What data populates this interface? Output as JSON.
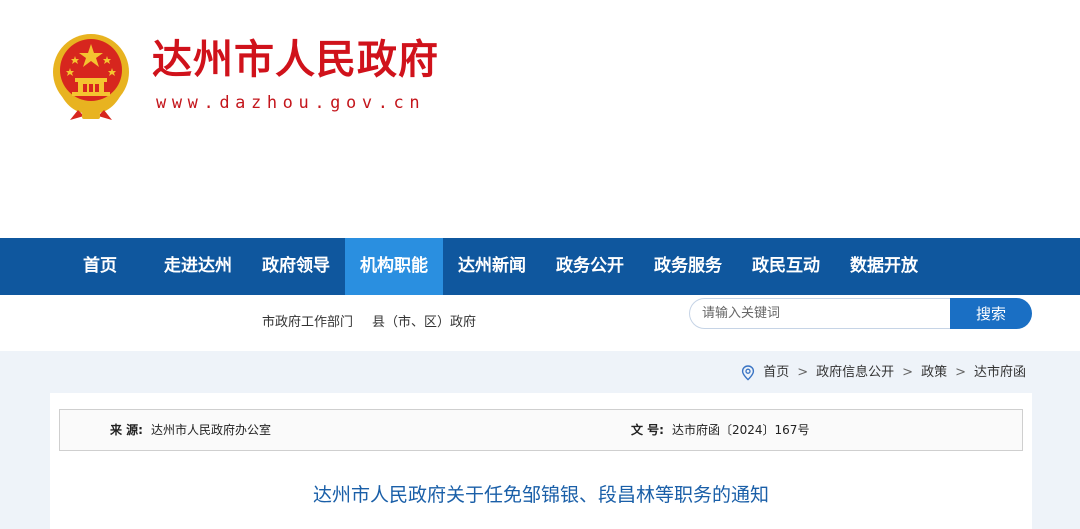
{
  "header": {
    "site_title": "达州市人民政府",
    "site_url": "www.dazhou.gov.cn",
    "emblem_icon": "national-emblem-icon"
  },
  "nav": {
    "items": [
      {
        "label": "首页"
      },
      {
        "label": "走进达州"
      },
      {
        "label": "政府领导"
      },
      {
        "label": "机构职能",
        "active": true
      },
      {
        "label": "达州新闻"
      },
      {
        "label": "政务公开"
      },
      {
        "label": "政务服务"
      },
      {
        "label": "政民互动"
      },
      {
        "label": "数据开放"
      }
    ],
    "active_color": "#2a8fe0",
    "background_color": "#0f579e"
  },
  "subnav": {
    "links": [
      {
        "label": "市政府工作部门"
      },
      {
        "label": "县（市、区）政府"
      }
    ]
  },
  "search": {
    "placeholder": "请输入关键词",
    "value": "",
    "button_label": "搜索"
  },
  "breadcrumb": {
    "icon": "location-pin-icon",
    "items": [
      "首页",
      "政府信息公开",
      "政策",
      "达市府函"
    ],
    "separator": ">"
  },
  "document": {
    "source_label": "来  源:",
    "source_value": "达州市人民政府办公室",
    "number_label": "文  号:",
    "number_value": "达市府函〔2024〕167号",
    "title": "达州市人民政府关于任免邹锦银、段昌林等职务的通知"
  },
  "colors": {
    "brand_red": "#d0121b",
    "title_blue": "#1a5fa8",
    "search_button": "#1a6fc4"
  }
}
